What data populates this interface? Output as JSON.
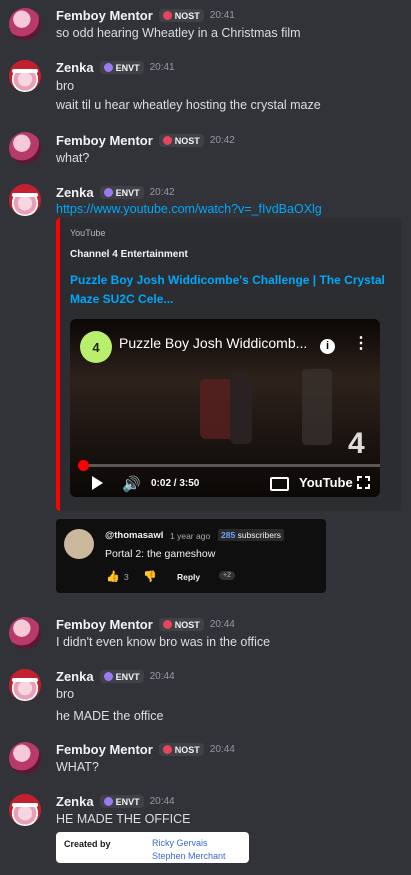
{
  "messages": [
    {
      "author": "Femboy Mentor",
      "tag": "NOST",
      "time": "20:41",
      "lines": [
        "so odd hearing Wheatley in a Christmas film"
      ]
    },
    {
      "author": "Zenka",
      "tag": "ENVT",
      "time": "20:41",
      "lines": [
        "bro",
        "wait til u hear wheatley hosting the crystal maze"
      ]
    },
    {
      "author": "Femboy Mentor",
      "tag": "NOST",
      "time": "20:42",
      "lines": [
        "what?"
      ]
    },
    {
      "author": "Zenka",
      "tag": "ENVT",
      "time": "20:42",
      "link": "https://www.youtube.com/watch?v=_fIvdBaOXlg"
    },
    {
      "author": "Femboy Mentor",
      "tag": "NOST",
      "time": "20:44",
      "lines": [
        "I didn't even know bro was in the office"
      ]
    },
    {
      "author": "Zenka",
      "tag": "ENVT",
      "time": "20:44",
      "lines": [
        "bro",
        "he MADE the office"
      ]
    },
    {
      "author": "Femboy Mentor",
      "tag": "NOST",
      "time": "20:44",
      "lines": [
        "WHAT?"
      ]
    },
    {
      "author": "Zenka",
      "tag": "ENVT",
      "time": "20:44",
      "lines": [
        "HE MADE THE OFFICE"
      ]
    }
  ],
  "embed": {
    "provider": "YouTube",
    "author": "Channel 4 Entertainment",
    "title": "Puzzle Boy Josh Widdicombe's Challenge | The Crystal Maze SU2C Cele...",
    "accent": "#ff0000",
    "video": {
      "title": "Puzzle Boy Josh Widdicomb...",
      "time": "0:02 / 3:50",
      "progress": 0.01,
      "brand": "YouTube",
      "channel_logo": "4",
      "watermark": "4"
    }
  },
  "comment": {
    "user": "@thomasawl",
    "age": "1 year ago",
    "subs_count": "285",
    "subs_label": "subscribers",
    "text": "Portal 2: the gameshow",
    "likes": "3",
    "reply": "Reply",
    "reply_count": "+2"
  },
  "credits": {
    "label": "Created by",
    "names": [
      "Ricky Gervais",
      "Stephen Merchant"
    ]
  },
  "colors": {
    "background": "#313338",
    "link": "#00a8fc",
    "nost": "#e8455d",
    "envt": "#9b7af0"
  }
}
